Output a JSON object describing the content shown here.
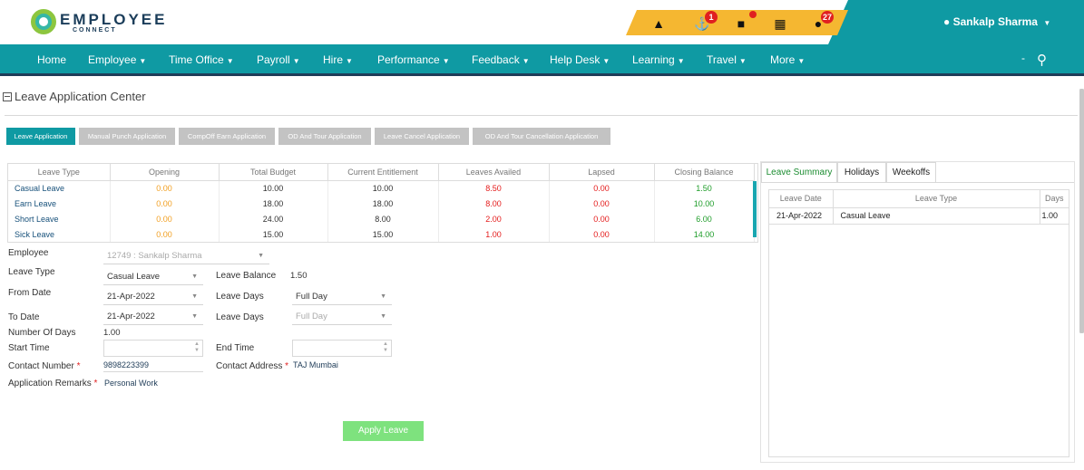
{
  "app": {
    "logo_text": "EMPLOYEE",
    "logo_sub": "CONNECT",
    "user_name": "Sankalp Sharma",
    "badges": {
      "cake": "1",
      "chat": "",
      "bell": "27"
    }
  },
  "nav": {
    "items": [
      "Home",
      "Employee",
      "Time Office",
      "Payroll",
      "Hire",
      "Performance",
      "Feedback",
      "Help Desk",
      "Learning",
      "Travel",
      "More"
    ],
    "dash": "-"
  },
  "page": {
    "title": "Leave Application Center"
  },
  "tabs": [
    "Leave Application",
    "Manual Punch Application",
    "CompOff Earn Application",
    "OD And Tour Application",
    "Leave Cancel Application",
    "OD And Tour Cancellation Application"
  ],
  "balance_table": {
    "headers": [
      "Leave Type",
      "Opening",
      "Total Budget",
      "Current Entitlement",
      "Leaves Availed",
      "Lapsed",
      "Closing Balance"
    ],
    "rows": [
      [
        "Casual Leave",
        "0.00",
        "10.00",
        "10.00",
        "8.50",
        "0.00",
        "1.50"
      ],
      [
        "Earn Leave",
        "0.00",
        "18.00",
        "18.00",
        "8.00",
        "0.00",
        "10.00"
      ],
      [
        "Short Leave",
        "0.00",
        "24.00",
        "8.00",
        "2.00",
        "0.00",
        "6.00"
      ],
      [
        "Sick Leave",
        "0.00",
        "15.00",
        "15.00",
        "1.00",
        "0.00",
        "14.00"
      ]
    ]
  },
  "form": {
    "employee_label": "Employee",
    "employee_value": "12749 : Sankalp Sharma",
    "leave_type_label": "Leave Type",
    "leave_type_value": "Casual Leave",
    "leave_balance_label": "Leave Balance",
    "leave_balance_value": "1.50",
    "from_date_label": "From Date",
    "from_date_value": "21-Apr-2022",
    "leave_days_label": "Leave Days",
    "leave_days_value": "Full Day",
    "to_date_label": "To Date",
    "to_date_value": "21-Apr-2022",
    "leave_days2_label": "Leave Days",
    "leave_days2_value": "Full Day",
    "num_days_label": "Number Of Days",
    "num_days_value": "1.00",
    "start_time_label": "Start Time",
    "end_time_label": "End Time",
    "contact_number_label": "Contact Number",
    "contact_number_value": "9898223399",
    "contact_address_label": "Contact Address",
    "contact_address_value": "TAJ Mumbai",
    "remarks_label": "Application Remarks",
    "remarks_value": "Personal Work",
    "required_mark": "*",
    "apply_label": "Apply Leave"
  },
  "right_panel": {
    "tabs": [
      "Leave Summary",
      "Holidays",
      "Weekoffs"
    ],
    "headers": [
      "Leave Date",
      "Leave Type",
      "Days"
    ],
    "rows": [
      [
        "21-Apr-2022",
        "Casual Leave",
        "1.00"
      ]
    ]
  },
  "colors": {
    "teal": "#0f9aa3",
    "navy": "#1f3c58",
    "amber": "#f5b731",
    "green": "#1f9d2a",
    "red": "#e41b1b"
  }
}
